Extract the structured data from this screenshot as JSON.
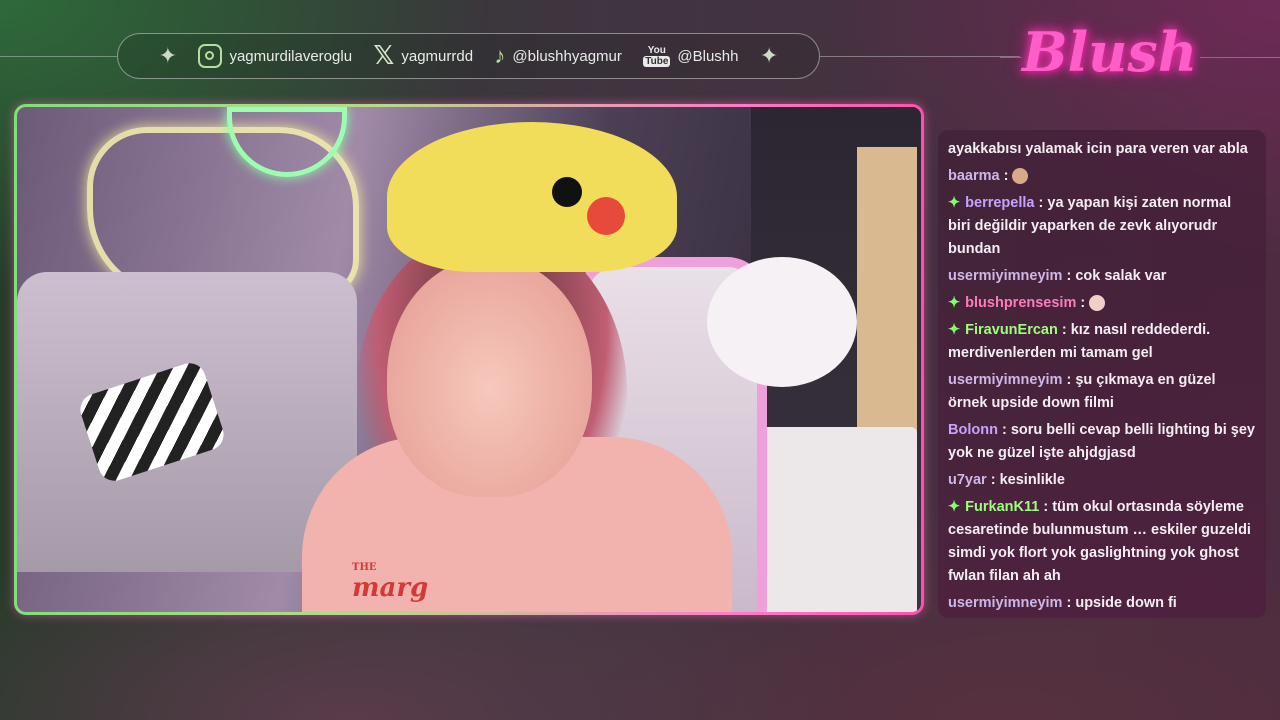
{
  "social": {
    "instagram": "yagmurdilaveroglu",
    "x": "yagmurrdd",
    "tiktok": "@blushhyagmur",
    "youtube_top": "You",
    "youtube_bottom": "Tube",
    "youtube": "@Blushh"
  },
  "logo": "Blush",
  "video": {
    "shirt_line1": "THE",
    "shirt_line2": "marg"
  },
  "chat": {
    "messages": [
      {
        "user": "",
        "text": "ayakkabısı yalamak icin para veren var abla"
      },
      {
        "user": "baarma",
        "text": ""
      },
      {
        "user": "berrepella",
        "text": "ya yapan kişi zaten normal biri değildir yaparken de zevk alıyorudr bundan"
      },
      {
        "user": "usermiyimneyim",
        "text": "cok salak var"
      },
      {
        "user": "blushprensesim",
        "text": ""
      },
      {
        "user": "FiravunErcan",
        "text": "kız nasıl reddederdi. merdivenlerden mi tamam gel"
      },
      {
        "user": "usermiyimneyim",
        "text": "şu çıkmaya en güzel örnek upside down filmi"
      },
      {
        "user": "Bolonn",
        "text": "soru belli cevap belli lighting bi şey yok ne güzel işte ahjdgjasd"
      },
      {
        "user": "u7yar",
        "text": "kesinlikle"
      },
      {
        "user": "FurkanK11",
        "text": "tüm okul ortasında söyleme cesaretinde bulunmustum … eskiler guzeldi simdi yok flort yok gaslightning yok ghost fwlan filan ah ah"
      },
      {
        "user": "usermiyimneyim",
        "text": "upside down fi"
      }
    ]
  }
}
